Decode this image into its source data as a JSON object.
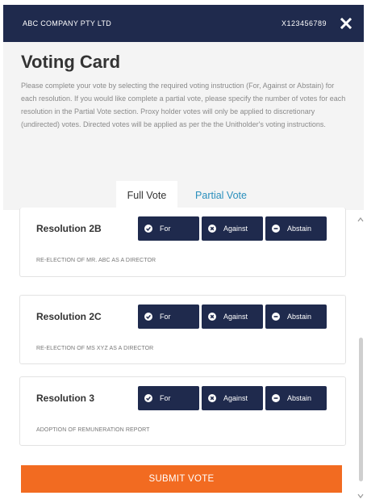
{
  "window": {
    "company": "ABC COMPANY PTY LTD",
    "code": "X123456789"
  },
  "header": {
    "title": "Voting Card",
    "intro": "Please complete your vote by selecting the required voting instruction (For, Against or Abstain) for each resolution. If you would like complete a partial vote, please specify the number of votes for each resolution in the Partial Vote section. Proxy holder votes will only be applied to discretionary (undirected) votes. Directed votes will be applied as per the the Unitholder's voting instructions."
  },
  "tabs": {
    "full_vote": "Full Vote",
    "partial_vote": "Partial Vote",
    "active": "Full Vote"
  },
  "resolutions": [
    {
      "title": "Resolution 2B",
      "description": "RE-ELECTION OF MR. ABC AS A DIRECTOR"
    },
    {
      "title": "Resolution 2C",
      "description": "RE-ELECTION OF MS XYZ AS A DIRECTOR"
    },
    {
      "title": "Resolution 3",
      "description": "ADOPTION OF REMUNERATION REPORT"
    }
  ],
  "vote_options": {
    "for": "For",
    "against": "Against",
    "abstain": "Abstain"
  },
  "submit_label": "SUBMIT VOTE",
  "icons": {
    "close": "close-icon",
    "for": "check-circle-icon",
    "against": "x-circle-icon",
    "abstain": "minus-circle-icon"
  },
  "colors": {
    "navy": "#1f2a4d",
    "orange": "#f26b21",
    "link_blue": "#2a8fbd"
  }
}
